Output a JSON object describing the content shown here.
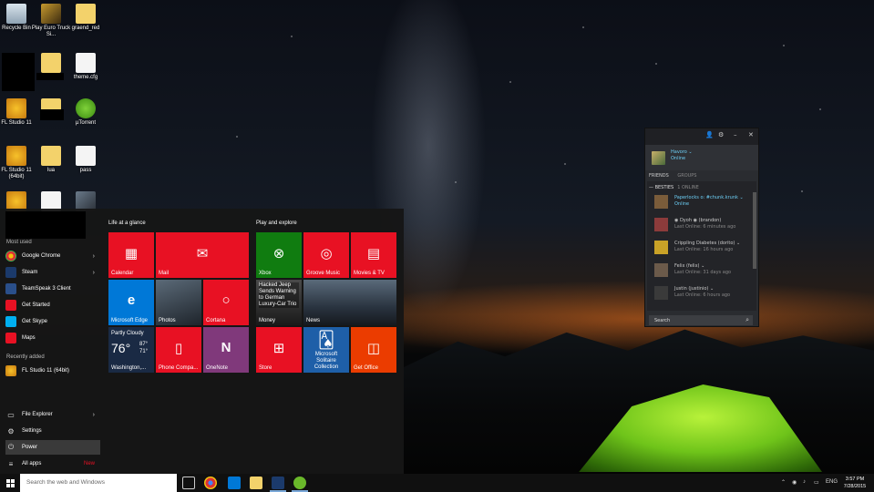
{
  "desktop": {
    "icons": [
      {
        "label": "Recycle Bin"
      },
      {
        "label": "Play Euro Truck Si..."
      },
      {
        "label": "graend_red"
      },
      {
        "label": "theme.cfg"
      },
      {
        "label": "FL Studio 11"
      },
      {
        "label": "µTorrent"
      },
      {
        "label": "FL Studio 11 (64bit)"
      },
      {
        "label": "lua"
      },
      {
        "label": "pass"
      }
    ]
  },
  "start_menu": {
    "most_used_label": "Most used",
    "recently_added_label": "Recently added",
    "most_used": [
      {
        "label": "Google Chrome",
        "color": "#2a8f3b"
      },
      {
        "label": "Steam",
        "color": "#1b3a6b"
      },
      {
        "label": "TeamSpeak 3 Client",
        "color": "#2a4f8a"
      },
      {
        "label": "Get Started",
        "color": "#e81123"
      },
      {
        "label": "Get Skype",
        "color": "#00aff0"
      },
      {
        "label": "Maps",
        "color": "#e81123"
      }
    ],
    "recently_added": [
      {
        "label": "FL Studio 11 (64bit)",
        "color": "#e5a41a"
      }
    ],
    "bottom": {
      "file_explorer": "File Explorer",
      "settings": "Settings",
      "power": "Power",
      "all_apps": "All apps",
      "new_badge": "New"
    },
    "groups": {
      "life": "Life at a glance",
      "play": "Play and explore"
    },
    "tiles": {
      "calendar": "Calendar",
      "mail": "Mail",
      "edge": "Microsoft Edge",
      "photos": "Photos",
      "cortana": "Cortana",
      "weather": {
        "condition": "Partly Cloudy",
        "temp": "76°",
        "high": "87°",
        "low": "71°",
        "city": "Washington,..."
      },
      "phone": "Phone Compa...",
      "onenote": "OneNote",
      "xbox": "Xbox",
      "groove": "Groove Music",
      "movies": "Movies & TV",
      "money": "Money",
      "money_headline": "Hacked Jeep Sends Warning to German Luxury-Car Trio",
      "news": "News",
      "store": "Store",
      "solitaire": "Microsoft Solitaire Collection",
      "office": "Get Office"
    }
  },
  "steam": {
    "username": "Havoro ⌄",
    "status": "Online",
    "tab_friends": "FRIENDS",
    "tab_groups": "GROUPS",
    "group_name": "— BESTIES",
    "group_count": "1 ONLINE",
    "friends": [
      {
        "name": "Paperlocks o: #chunk.krunk ⌄",
        "status": "Online",
        "online": true,
        "color": "#7a5c3a"
      },
      {
        "name": "◉ Dyoh ◉ (brandon)",
        "status": "Last Online: 6 minutes ago",
        "online": false,
        "color": "#8c3b3b"
      },
      {
        "name": "Crippling Diabetes (dorito) ⌄",
        "status": "Last Online: 16 hours ago",
        "online": false,
        "color": "#c9a227"
      },
      {
        "name": "Felix (felix) ⌄",
        "status": "Last Online: 31 days ago",
        "online": false,
        "color": "#6b5a4a"
      },
      {
        "name": "Justin (justinio) ⌄",
        "status": "Last Online: 6 hours ago",
        "online": false,
        "color": "#3a3a3a"
      }
    ],
    "search_label": "Search"
  },
  "taskbar": {
    "search_placeholder": "Search the web and Windows",
    "language": "ENG",
    "time": "3:57 PM",
    "date": "7/28/2015"
  }
}
